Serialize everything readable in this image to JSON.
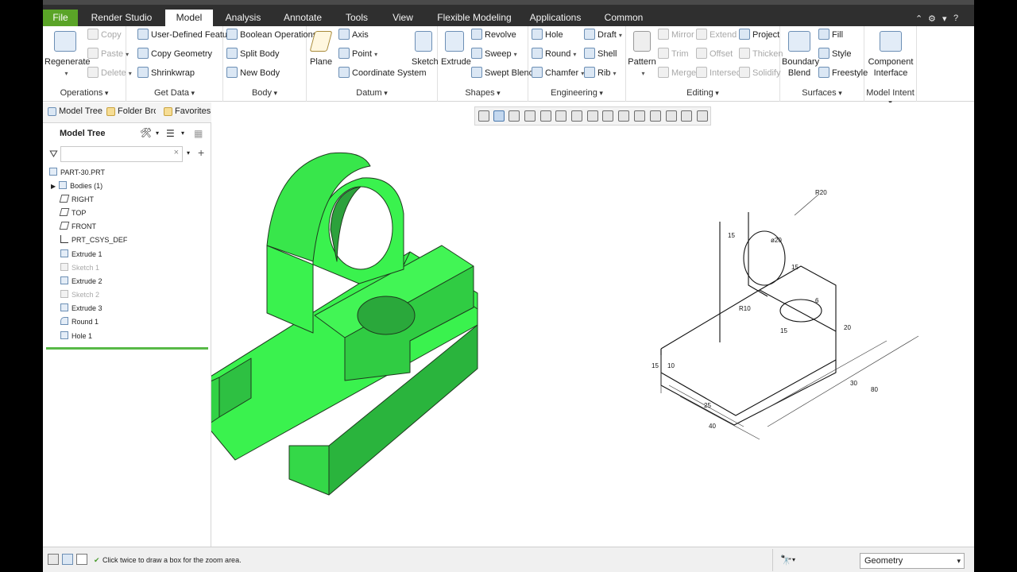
{
  "tabs": [
    "File",
    "Render Studio",
    "Model",
    "Analysis",
    "Annotate",
    "Tools",
    "View",
    "Flexible Modeling",
    "Applications",
    "Common"
  ],
  "ribbon": {
    "operations": {
      "label": "Operations",
      "regenerate": "Regenerate",
      "copy": "Copy",
      "paste": "Paste",
      "delete": "Delete"
    },
    "getdata": {
      "label": "Get Data",
      "user_defined": "User-Defined Feature",
      "copy_geometry": "Copy Geometry",
      "shrinkwrap": "Shrinkwrap"
    },
    "body": {
      "label": "Body",
      "boolean": "Boolean Operations",
      "split": "Split Body",
      "new": "New Body"
    },
    "datum": {
      "label": "Datum",
      "plane": "Plane",
      "axis": "Axis",
      "point": "Point",
      "csys": "Coordinate System",
      "sketch": "Sketch"
    },
    "shapes": {
      "label": "Shapes",
      "extrude": "Extrude",
      "revolve": "Revolve",
      "sweep": "Sweep",
      "swept_blend": "Swept Blend"
    },
    "engineering": {
      "label": "Engineering",
      "hole": "Hole",
      "round": "Round",
      "chamfer": "Chamfer",
      "draft": "Draft",
      "shell": "Shell",
      "rib": "Rib"
    },
    "editing": {
      "label": "Editing",
      "pattern": "Pattern",
      "mirror": "Mirror",
      "trim": "Trim",
      "merge": "Merge",
      "extend": "Extend",
      "offset": "Offset",
      "intersect": "Intersect",
      "project": "Project",
      "thicken": "Thicken",
      "solidify": "Solidify"
    },
    "surfaces": {
      "label": "Surfaces",
      "boundary": "Boundary",
      "blend": "Blend",
      "fill": "Fill",
      "style": "Style",
      "freestyle": "Freestyle"
    },
    "modelintent": {
      "label": "Model Intent",
      "component": "Component",
      "interface": "Interface"
    }
  },
  "panel_tabs": [
    "Model Tree",
    "Folder Bro",
    "Favorites"
  ],
  "tree": {
    "title": "Model Tree",
    "nodes": [
      "PART-30.PRT",
      "Bodies (1)",
      "RIGHT",
      "TOP",
      "FRONT",
      "PRT_CSYS_DEF",
      "Extrude 1",
      "Sketch 1",
      "Extrude 2",
      "Sketch 2",
      "Extrude 3",
      "Round 1",
      "Hole 1"
    ]
  },
  "drawing": {
    "dims": [
      "R20",
      "15",
      "ø20",
      "15",
      "R10",
      "6",
      "15",
      "20",
      "15",
      "10",
      "25",
      "40",
      "30",
      "80"
    ]
  },
  "status": {
    "message": "Click twice to draw a box for the zoom area.",
    "filter": "Geometry"
  },
  "colors": {
    "model_green": "#3af24e",
    "file_tab": "#5aa427",
    "tree_separator": "#58b947"
  }
}
